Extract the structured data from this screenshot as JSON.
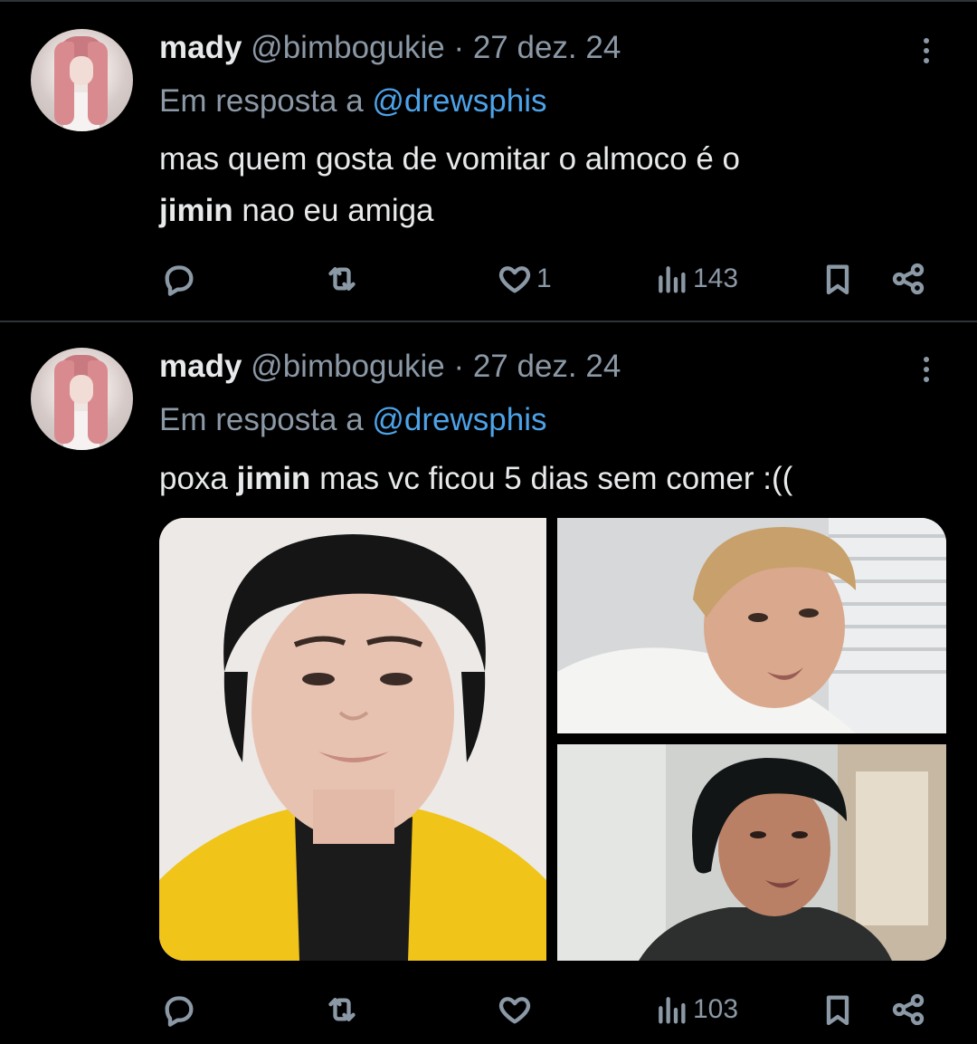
{
  "tweets": [
    {
      "name": "mady",
      "handle": "@bimbogukie",
      "sep": "·",
      "date": "27 dez. 24",
      "reply_prefix": "Em resposta a",
      "reply_to": "@drewsphis",
      "text_parts": [
        "mas quem gosta de vomitar o almoco é o",
        "jimin",
        "nao eu amiga"
      ],
      "stats": {
        "replies": "",
        "retweets": "",
        "likes": "1",
        "views": "143"
      }
    },
    {
      "name": "mady",
      "handle": "@bimbogukie",
      "sep": "·",
      "date": "27 dez. 24",
      "reply_prefix": "Em resposta a",
      "reply_to": "@drewsphis",
      "text_parts": [
        "poxa",
        "jimin",
        "mas vc ficou 5 dias sem comer :(("
      ],
      "stats": {
        "replies": "",
        "retweets": "",
        "likes": "",
        "views": "103"
      },
      "media": [
        "photo-1",
        "photo-2",
        "photo-3"
      ]
    }
  ],
  "icons": {
    "reply": "reply-icon",
    "retweet": "retweet-icon",
    "like": "heart-icon",
    "views": "views-icon",
    "bookmark": "bookmark-icon",
    "share": "share-icon",
    "more": "more-icon"
  },
  "colors": {
    "background": "#000000",
    "text": "#e7e9ea",
    "muted": "#8b98a5",
    "mention": "#4da3e9",
    "divider": "#2f3336"
  }
}
